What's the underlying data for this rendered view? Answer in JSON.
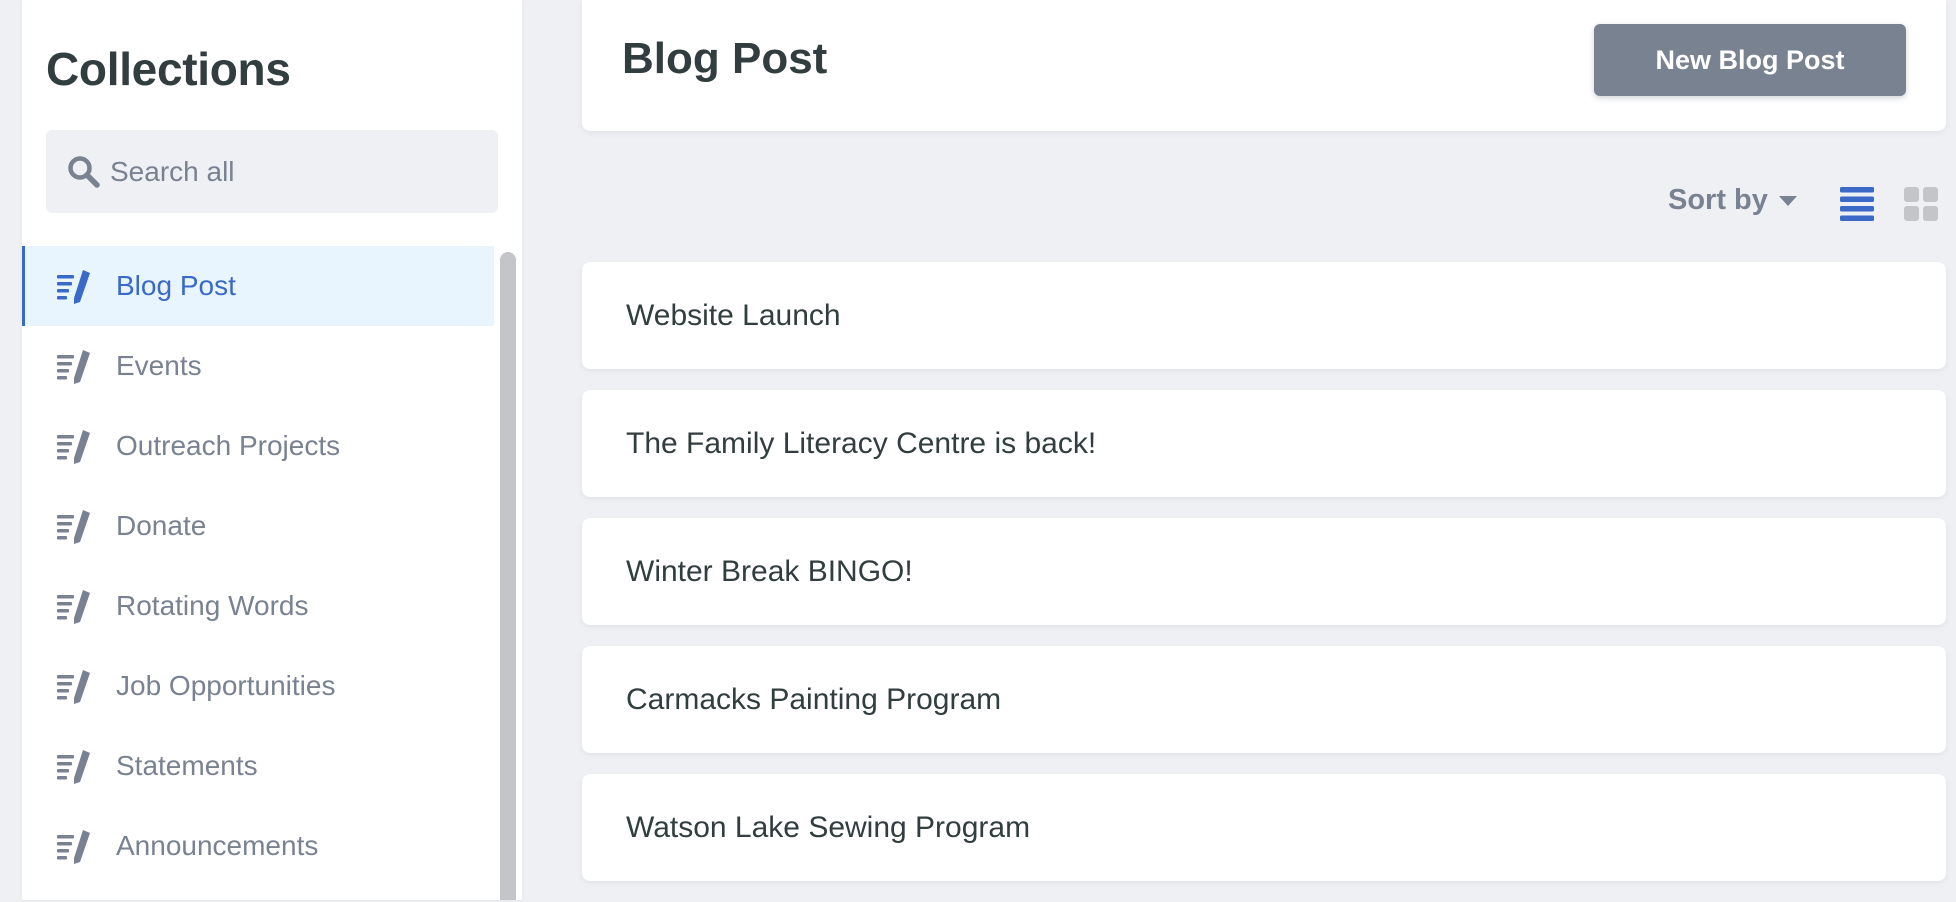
{
  "sidebar": {
    "title": "Collections",
    "search": {
      "placeholder": "Search all",
      "value": ""
    },
    "items": [
      {
        "label": "Blog Post",
        "active": true
      },
      {
        "label": "Events",
        "active": false
      },
      {
        "label": "Outreach Projects",
        "active": false
      },
      {
        "label": "Donate",
        "active": false
      },
      {
        "label": "Rotating Words",
        "active": false
      },
      {
        "label": "Job Opportunities",
        "active": false
      },
      {
        "label": "Statements",
        "active": false
      },
      {
        "label": "Announcements",
        "active": false
      }
    ]
  },
  "header": {
    "title": "Blog Post",
    "new_button_label": "New Blog Post"
  },
  "toolbar": {
    "sort_label": "Sort by",
    "view_mode": "list"
  },
  "entries": [
    {
      "title": "Website Launch"
    },
    {
      "title": "The Family Literacy Centre is back!"
    },
    {
      "title": "Winter Break BINGO!"
    },
    {
      "title": "Carmacks Painting Program"
    },
    {
      "title": "Watson Lake Sewing Program"
    }
  ],
  "colors": {
    "accent": "#3a69c7",
    "active_bg": "#e8f5fe",
    "muted": "#798291",
    "text": "#313d3e",
    "background": "#eff0f4",
    "button_bg": "#798291"
  },
  "icons": {
    "search": "search-icon",
    "collection": "write-icon",
    "sort_caret": "caret-down-icon",
    "view_list": "list-view-icon",
    "view_grid": "grid-view-icon"
  }
}
